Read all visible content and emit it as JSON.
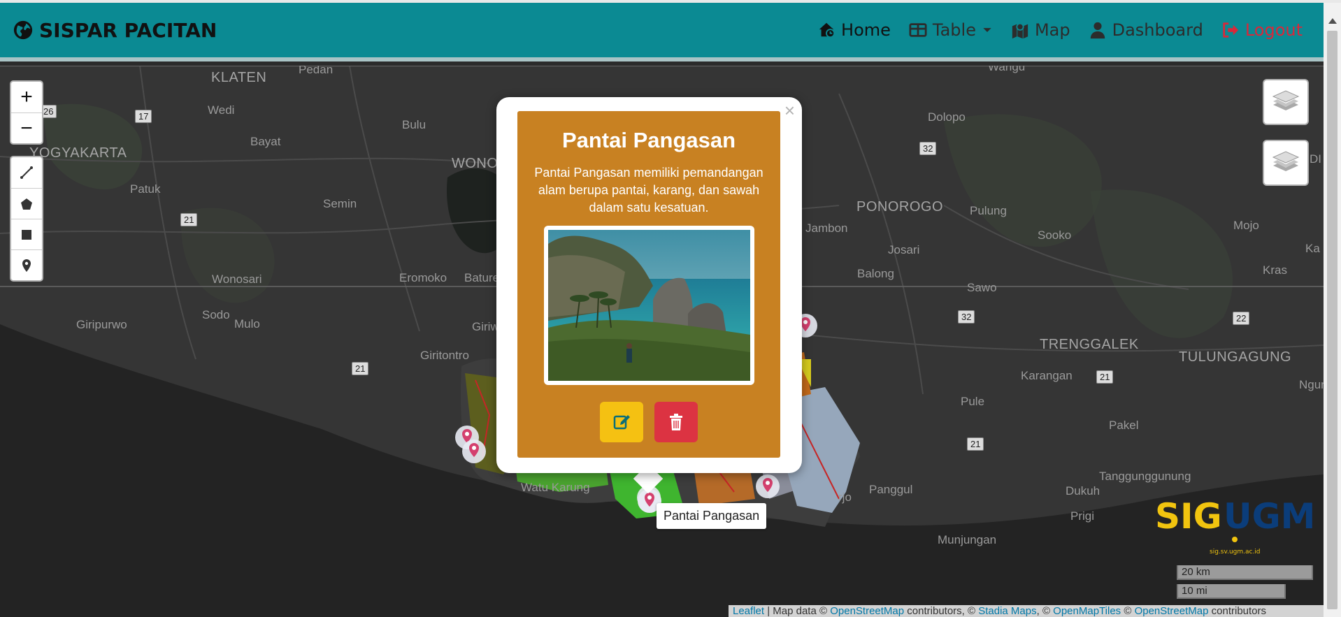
{
  "navbar": {
    "brand": "SISPAR PACITAN",
    "items": [
      {
        "label": "Home",
        "icon": "house-icon"
      },
      {
        "label": "Table",
        "icon": "table-icon"
      },
      {
        "label": "Map",
        "icon": "map-icon"
      },
      {
        "label": "Dashboard",
        "icon": "user-icon"
      },
      {
        "label": "Logout",
        "icon": "logout-icon"
      }
    ]
  },
  "map": {
    "place_labels": [
      "KLATEN",
      "Pedan",
      "Wedi",
      "Bulu",
      "Bayat",
      "YOGYAKARTA",
      "WONO",
      "Patuk",
      "Semin",
      "Wonosari",
      "Eromoko",
      "Bature",
      "Sodo",
      "Mulo",
      "Giripurwo",
      "Giriw",
      "Giritontro",
      "Dolopo",
      "PONOROGO",
      "Jambon",
      "Pulung",
      "Sooko",
      "Mojo",
      "Ka",
      "Josari",
      "Balong",
      "Sawo",
      "Kras",
      "TRENGGALEK",
      "TULUNGAGUNG",
      "Karangan",
      "Ngunu",
      "Pule",
      "Pakel",
      "Tanggunggunung",
      "Panggul",
      "Dukuh",
      "Prigi",
      "Munjungan",
      "Watu Karung",
      "rjo",
      "DI",
      "Wangu"
    ],
    "road_numbers": [
      "26",
      "17",
      "21",
      "21",
      "32",
      "32",
      "22",
      "21",
      "21"
    ],
    "zoom_in": "+",
    "zoom_out": "−"
  },
  "popup": {
    "close": "×",
    "title": "Pantai Pangasan",
    "description": "Pantai Pangasan memiliki pemandangan alam berupa pantai, karang, dan sawah dalam satu kesatuan.",
    "edit_icon": "edit-icon",
    "delete_icon": "trash-icon"
  },
  "tooltip": "Pantai Pangasan",
  "logo": {
    "text_a": "SIG",
    "text_b": "UGM",
    "url": "sig.sv.ugm.ac.id"
  },
  "scale": {
    "km": "20 km",
    "mi": "10 mi"
  },
  "attribution": {
    "leaflet": "Leaflet",
    "map_data": " | Map data © ",
    "osm": "OpenStreetMap",
    "contrib": " contributors, © ",
    "stadia": "Stadia Maps",
    "sep": ", © ",
    "omt": "OpenMapTiles",
    "sep2": " © ",
    "osm2": "OpenStreetMap",
    "contrib2": " contributors"
  },
  "colors": {
    "navbar": "#0b8a93",
    "card": "#c88122",
    "edit": "#f5c112",
    "delete": "#dc3342",
    "logout": "#d9283a"
  }
}
